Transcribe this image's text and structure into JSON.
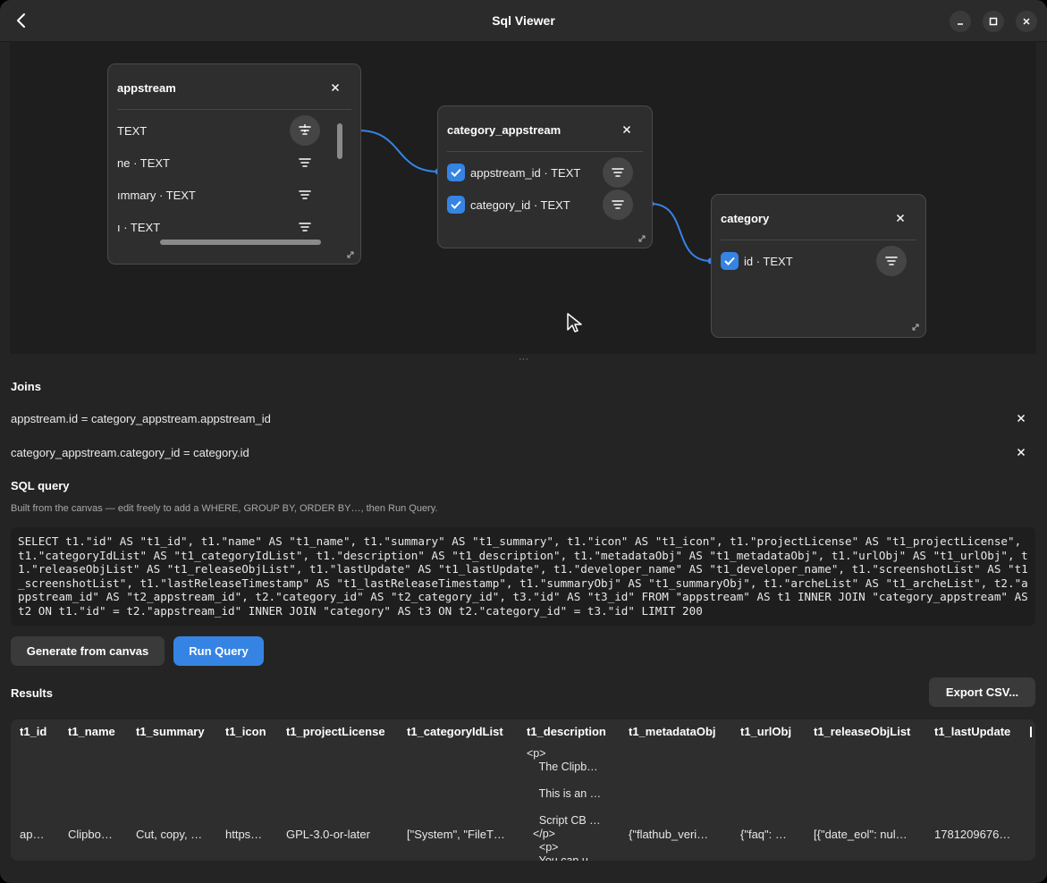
{
  "window": {
    "title": "Sql Viewer"
  },
  "canvas": {
    "tables": [
      {
        "name": "appstream",
        "columns": [
          {
            "label": "TEXT"
          },
          {
            "label": "ne · TEXT"
          },
          {
            "label": "ımmary · TEXT"
          },
          {
            "label": "ı · TEXT"
          }
        ]
      },
      {
        "name": "category_appstream",
        "columns": [
          {
            "label": "appstream_id · TEXT"
          },
          {
            "label": "category_id · TEXT"
          }
        ]
      },
      {
        "name": "category",
        "columns": [
          {
            "label": "id · TEXT"
          }
        ]
      }
    ],
    "splitter_handle": "···"
  },
  "joins": {
    "heading": "Joins",
    "items": [
      "appstream.id = category_appstream.appstream_id",
      "category_appstream.category_id = category.id"
    ]
  },
  "sql": {
    "heading": "SQL query",
    "hint": "Built from the canvas — edit freely to add a WHERE, GROUP BY, ORDER BY…, then Run Query.",
    "text": "SELECT t1.\"id\" AS \"t1_id\", t1.\"name\" AS \"t1_name\", t1.\"summary\" AS \"t1_summary\", t1.\"icon\" AS \"t1_icon\", t1.\"projectLicense\" AS \"t1_projectLicense\", t1.\"categoryIdList\" AS \"t1_categoryIdList\", t1.\"description\" AS \"t1_description\", t1.\"metadataObj\" AS \"t1_metadataObj\", t1.\"urlObj\" AS \"t1_urlObj\", t1.\"releaseObjList\" AS \"t1_releaseObjList\", t1.\"lastUpdate\" AS \"t1_lastUpdate\", t1.\"developer_name\" AS \"t1_developer_name\", t1.\"screenshotList\" AS \"t1_screenshotList\", t1.\"lastReleaseTimestamp\" AS \"t1_lastReleaseTimestamp\", t1.\"summaryObj\" AS \"t1_summaryObj\", t1.\"archeList\" AS \"t1_archeList\", t2.\"appstream_id\" AS \"t2_appstream_id\", t2.\"category_id\" AS \"t2_category_id\", t3.\"id\" AS \"t3_id\" FROM \"appstream\" AS t1 INNER JOIN \"category_appstream\" AS t2 ON t1.\"id\" = t2.\"appstream_id\" INNER JOIN \"category\" AS t3 ON t2.\"category_id\" = t3.\"id\" LIMIT 200",
    "generate_label": "Generate from canvas",
    "run_label": "Run Query"
  },
  "results": {
    "heading": "Results",
    "export_label": "Export CSV...",
    "columns": [
      "t1_id",
      "t1_name",
      "t1_summary",
      "t1_icon",
      "t1_projectLicense",
      "t1_categoryIdList",
      "t1_description",
      "t1_metadataObj",
      "t1_urlObj",
      "t1_releaseObjList",
      "t1_lastUpdate"
    ],
    "row": {
      "t1_id": "ap…",
      "t1_name": "Clipbo…",
      "t1_summary": "Cut, copy, …",
      "t1_icon": "https…",
      "t1_projectLicense": "GPL-3.0-or-later",
      "t1_categoryIdList": "[\"System\", \"FileT…",
      "t1_description": "<p>\n    The Clipb…\n\n    This is an …\n\n    Script CB …\n  </p>\n    <p>\n    You can u…",
      "t1_metadataObj": "{\"flathub_veri…",
      "t1_urlObj": "{\"faq\": …",
      "t1_releaseObjList": "[{\"date_eol\": nul…",
      "t1_lastUpdate": "1781209676…"
    }
  },
  "colors": {
    "accent": "#3584e4",
    "bg": "#242424",
    "canvas": "#1e1e1e",
    "card": "#2e2e2e"
  },
  "icons": [
    "back-icon",
    "minimize-icon",
    "maximize-icon",
    "close-icon",
    "filter-icon",
    "checkbox-icon",
    "resize-grip-icon",
    "cursor-icon"
  ]
}
